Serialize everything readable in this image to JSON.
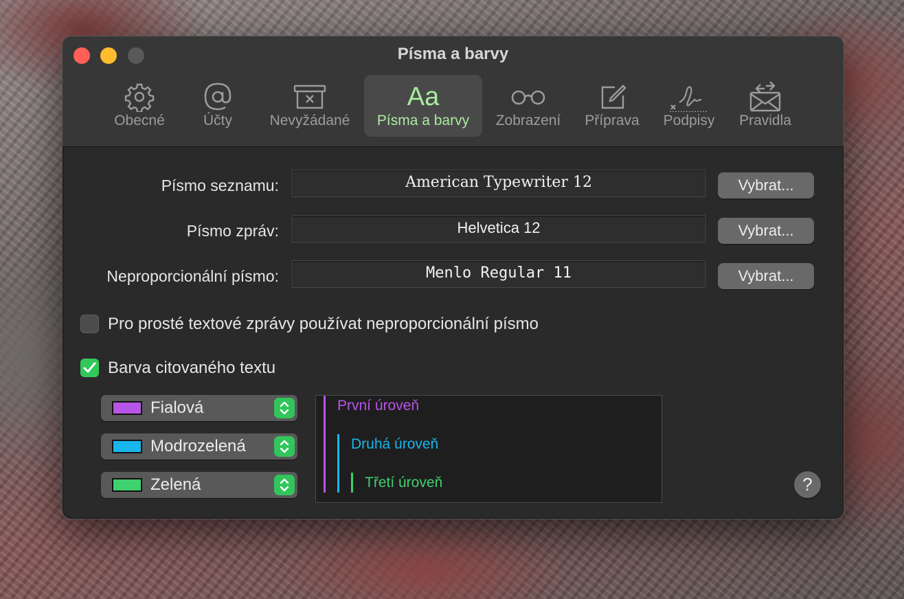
{
  "window": {
    "title": "Písma a barvy"
  },
  "toolbar": {
    "items": [
      {
        "label": "Obecné",
        "icon": "gear-icon",
        "active": false
      },
      {
        "label": "Účty",
        "icon": "at-icon",
        "active": false
      },
      {
        "label": "Nevyžádané",
        "icon": "junk-icon",
        "active": false
      },
      {
        "label": "Písma a barvy",
        "icon": "fonts-icon",
        "icon_text": "Aa",
        "active": true
      },
      {
        "label": "Zobrazení",
        "icon": "glasses-icon",
        "active": false
      },
      {
        "label": "Příprava",
        "icon": "compose-icon",
        "active": false
      },
      {
        "label": "Podpisy",
        "icon": "signature-icon",
        "active": false
      },
      {
        "label": "Pravidla",
        "icon": "rules-icon",
        "active": false
      }
    ]
  },
  "fonts": {
    "list": {
      "label": "Písmo seznamu:",
      "value": "American Typewriter 12",
      "button": "Vybrat..."
    },
    "message": {
      "label": "Písmo zpráv:",
      "value": "Helvetica 12",
      "button": "Vybrat..."
    },
    "fixed": {
      "label": "Neproporcionální písmo:",
      "value": "Menlo Regular 11",
      "button": "Vybrat..."
    }
  },
  "options": {
    "use_fixed_width": {
      "label": "Pro prosté textové zprávy používat neproporcionální písmo",
      "checked": false
    },
    "color_quoted": {
      "label": "Barva citovaného textu",
      "checked": true
    }
  },
  "quote_colors": [
    {
      "name": "Fialová",
      "color": "#b755e6"
    },
    {
      "name": "Modrozelená",
      "color": "#18b6ec"
    },
    {
      "name": "Zelená",
      "color": "#3fd16f"
    }
  ],
  "preview": {
    "levels": [
      {
        "label": "První úroveň",
        "color": "#b755e6"
      },
      {
        "label": "Druhá úroveň",
        "color": "#18b6ec"
      },
      {
        "label": "Třetí úroveň",
        "color": "#3fd16f"
      }
    ]
  },
  "help": {
    "label": "?"
  }
}
